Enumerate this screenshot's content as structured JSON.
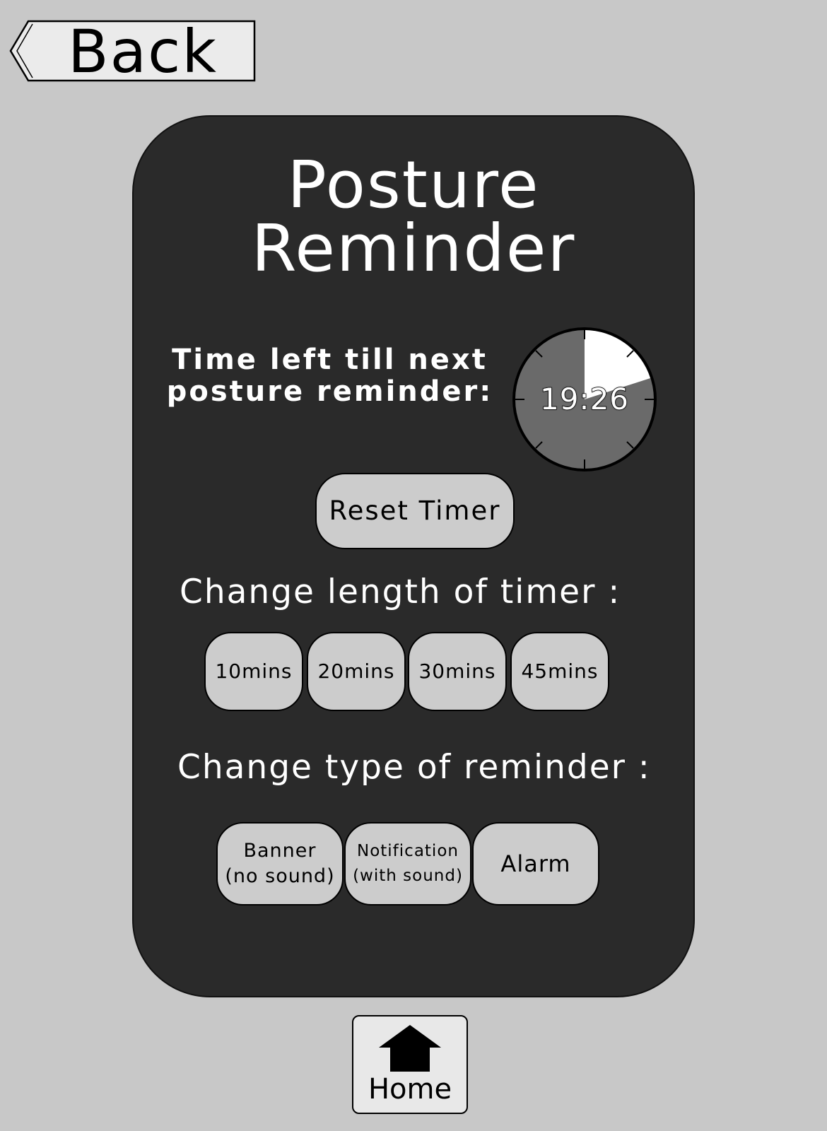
{
  "nav": {
    "back_label": "Back",
    "home_label": "Home"
  },
  "card": {
    "title_line1": "Posture",
    "title_line2": "Reminder",
    "time_left_line1": "Time left till next",
    "time_left_line2": "posture reminder:",
    "timer_display": "19:26",
    "reset_label": "Reset Timer",
    "length_label": "Change length of timer :",
    "length_options": [
      "10mins",
      "20mins",
      "30mins",
      "45mins"
    ],
    "type_label": "Change type of reminder :",
    "type_options": [
      {
        "line1": "Banner",
        "line2": "(no sound)"
      },
      {
        "line1": "Notification",
        "line2": "(with sound)"
      },
      {
        "line1": "Alarm",
        "line2": ""
      }
    ]
  },
  "colors": {
    "background": "#c8c8c8",
    "card": "#2a2a2a",
    "button": "#cccccc",
    "clock_face": "#6a6a6a",
    "clock_elapsed": "#ffffff"
  }
}
